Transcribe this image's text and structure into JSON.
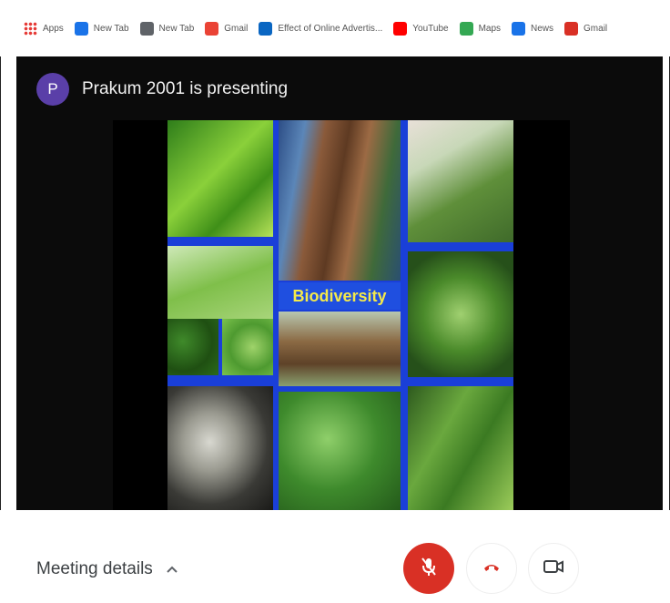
{
  "bookmarks": [
    {
      "label": "Apps",
      "icon": "apps-grid-icon",
      "color": "#e53935"
    },
    {
      "label": "New Tab",
      "icon": "gear-icon",
      "color": "#1a73e8"
    },
    {
      "label": "New Tab",
      "icon": "globe-icon",
      "color": "#5f6368"
    },
    {
      "label": "Gmail",
      "icon": "google-icon",
      "color": "#ea4335"
    },
    {
      "label": "Effect of Online Advertis...",
      "icon": "linkedin-icon",
      "color": "#0a66c2"
    },
    {
      "label": "YouTube",
      "icon": "youtube-icon",
      "color": "#ff0000"
    },
    {
      "label": "Maps",
      "icon": "maps-icon",
      "color": "#34a853"
    },
    {
      "label": "News",
      "icon": "news-icon",
      "color": "#1a73e8"
    },
    {
      "label": "Gmail",
      "icon": "gmail-icon",
      "color": "#d93025"
    }
  ],
  "presenter": {
    "initial": "P",
    "text": "Prakum 2001 is presenting",
    "avatar_color": "#5a3fa8"
  },
  "slide": {
    "label": "Biodiversity",
    "label_color": "#f4e94a",
    "border_color": "#1a3fd8"
  },
  "bottom": {
    "meeting_details": "Meeting details",
    "chevron": "^",
    "mic_color": "#d93025",
    "end_call_color": "#d93025"
  }
}
